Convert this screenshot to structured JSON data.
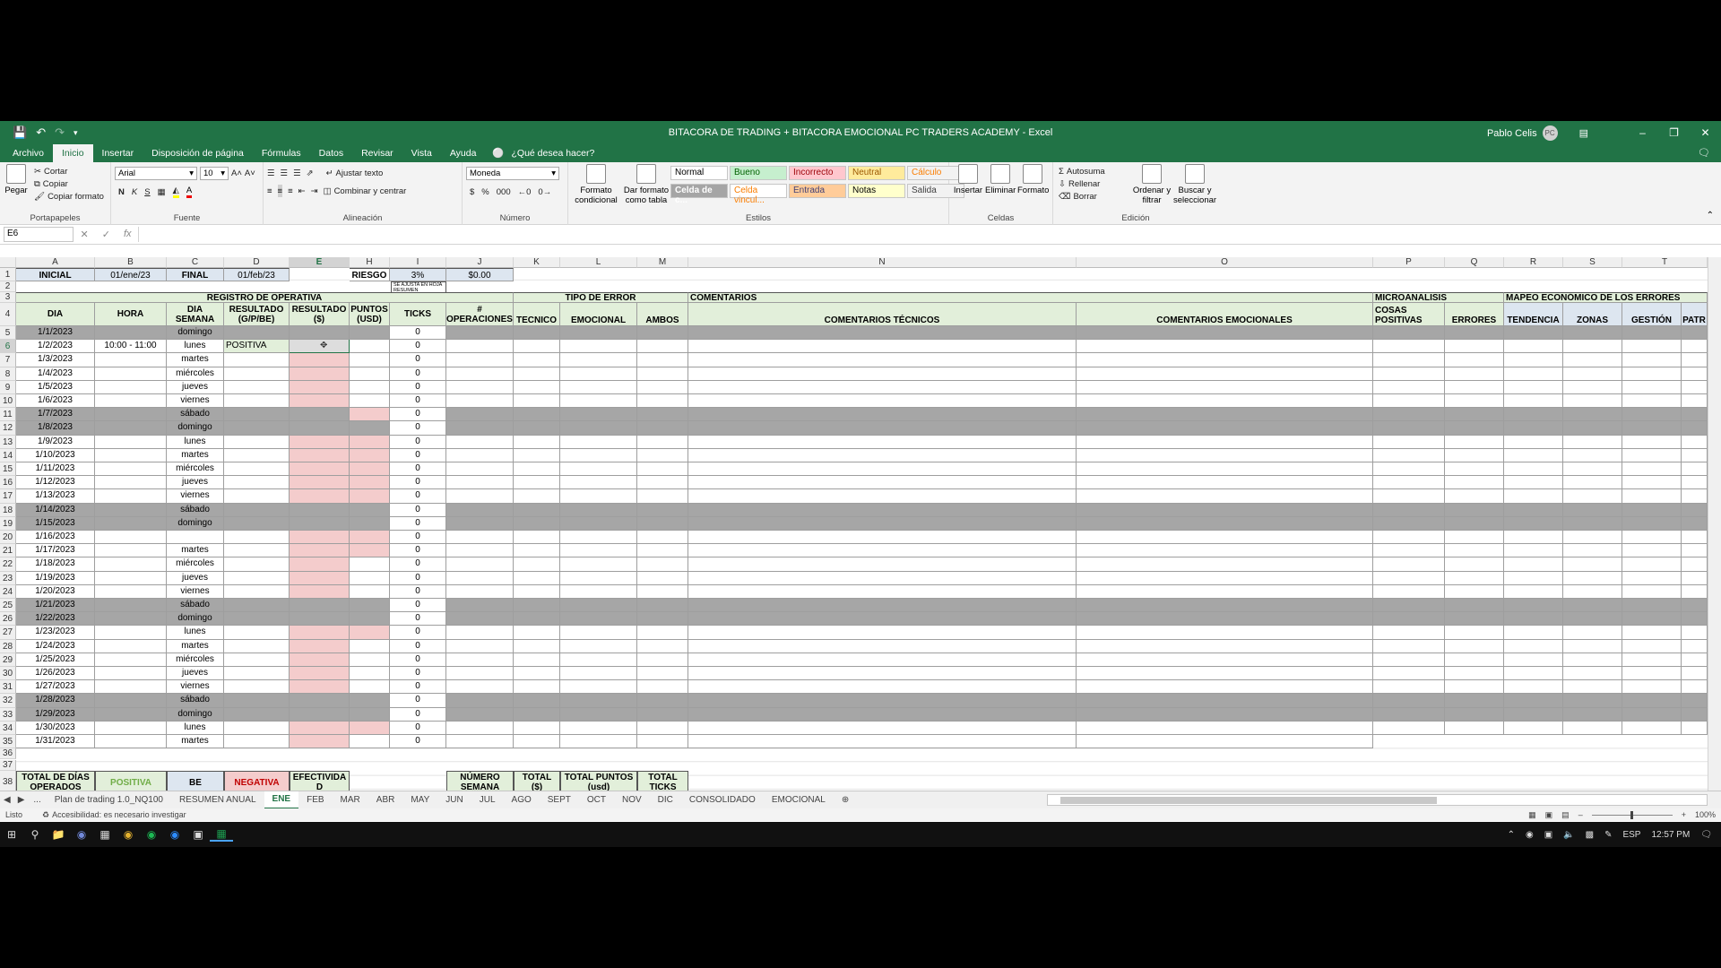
{
  "app": {
    "title": "BITACORA DE TRADING + BITACORA EMOCIONAL PC TRADERS ACADEMY  -  Excel",
    "user": "Pablo Celis",
    "user_initials": "PC"
  },
  "menu": {
    "tabs": [
      "Archivo",
      "Inicio",
      "Insertar",
      "Disposición de página",
      "Fórmulas",
      "Datos",
      "Revisar",
      "Vista",
      "Ayuda"
    ],
    "active": "Inicio",
    "tell_me": "¿Qué desea hacer?"
  },
  "ribbon": {
    "clipboard": {
      "paste": "Pegar",
      "cut": "Cortar",
      "copy": "Copiar",
      "format_painter": "Copiar formato",
      "label": "Portapapeles"
    },
    "font": {
      "name": "Arial",
      "size": "10",
      "bold": "N",
      "italic": "K",
      "underline": "S",
      "label": "Fuente"
    },
    "alignment": {
      "wrap": "Ajustar texto",
      "merge": "Combinar y centrar",
      "label": "Alineación"
    },
    "number": {
      "format": "Moneda",
      "label": "Número"
    },
    "styles": {
      "conditional": "Formato condicional",
      "as_table": "Dar formato como tabla",
      "label": "Estilos",
      "cells": [
        {
          "name": "Normal",
          "bg": "#ffffff",
          "fg": "#000000"
        },
        {
          "name": "Bueno",
          "bg": "#c6efce",
          "fg": "#006100"
        },
        {
          "name": "Incorrecto",
          "bg": "#ffc7ce",
          "fg": "#9c0006"
        },
        {
          "name": "Neutral",
          "bg": "#ffeb9c",
          "fg": "#9c5700"
        },
        {
          "name": "Cálculo",
          "bg": "#f2f2f2",
          "fg": "#fa7d00"
        },
        {
          "name": "Celda de c...",
          "bg": "#a5a5a5",
          "fg": "#ffffff"
        },
        {
          "name": "Celda vincul...",
          "bg": "#ffffff",
          "fg": "#fa7d00"
        },
        {
          "name": "Entrada",
          "bg": "#ffcc99",
          "fg": "#3f3f76"
        },
        {
          "name": "Notas",
          "bg": "#ffffcc",
          "fg": "#000000"
        },
        {
          "name": "Salida",
          "bg": "#f2f2f2",
          "fg": "#3f3f3f"
        }
      ]
    },
    "cells": {
      "insert": "Insertar",
      "delete": "Eliminar",
      "format": "Formato",
      "label": "Celdas"
    },
    "editing": {
      "autosum": "Autosuma",
      "fill": "Rellenar",
      "clear": "Borrar",
      "sort": "Ordenar y filtrar",
      "find": "Buscar y seleccionar",
      "label": "Edición"
    }
  },
  "formula": {
    "namebox": "E6",
    "content": ""
  },
  "columns": [
    "A",
    "B",
    "C",
    "D",
    "E",
    "",
    "H",
    "I",
    "J",
    "K",
    "L",
    "M",
    "N",
    "O",
    "P",
    "Q",
    "R",
    "S",
    "T"
  ],
  "header": {
    "inicial": "INICIAL",
    "fecha_inicial": "01/ene/23",
    "final": "FINAL",
    "fecha_final": "01/feb/23",
    "riesgo": "RIESGO",
    "riesgo_val": "3%",
    "j1": "$0.00",
    "note": "SE AJUSTA EN HOJA RESUMEN"
  },
  "sections": {
    "registro": "REGISTRO DE OPERATIVA",
    "tipo_error": "TIPO DE ERROR",
    "comentarios": "COMENTARIOS",
    "microanalisis": "MICROANALISIS",
    "mapeo": "MAPEO ECONÓMICO DE LOS ERRORES"
  },
  "col_headers": {
    "dia": "DIA",
    "hora": "HORA",
    "dia_semana": "DIA SEMANA",
    "resultado_gpbe": "RESULTADO (G/P/BE)",
    "resultado_usd": "RESULTADO ($)",
    "puntos": "PUNTOS (USD)",
    "ticks": "TICKS",
    "operaciones": "# OPERACIONES",
    "tecnico": "TECNICO",
    "emocional": "EMOCIONAL",
    "ambos": "AMBOS",
    "com_tecnicos": "COMENTARIOS TÉCNICOS",
    "com_emocionales": "COMENTARIOS EMOCIONALES",
    "cosas_positivas": "COSAS POSITIVAS",
    "errores": "ERRORES",
    "tendencia": "TENDENCIA",
    "zonas": "ZONAS",
    "gestion": "GESTIÓN",
    "patr": "PATR"
  },
  "rows": [
    {
      "n": "5",
      "date": "1/1/2023",
      "hour": "",
      "wd": "domingo",
      "res": "",
      "ticks": "0",
      "weekend": true,
      "h": false
    },
    {
      "n": "6",
      "date": "1/2/2023",
      "hour": "10:00  -  11:00",
      "wd": "lunes",
      "res": "POSITIVA",
      "ticks": "0",
      "weekend": false,
      "h": false
    },
    {
      "n": "7",
      "date": "1/3/2023",
      "hour": "",
      "wd": "martes",
      "res": "",
      "ticks": "0",
      "weekend": false,
      "h": false
    },
    {
      "n": "8",
      "date": "1/4/2023",
      "hour": "",
      "wd": "miércoles",
      "res": "",
      "ticks": "0",
      "weekend": false,
      "h": false
    },
    {
      "n": "9",
      "date": "1/5/2023",
      "hour": "",
      "wd": "jueves",
      "res": "",
      "ticks": "0",
      "weekend": false,
      "h": false
    },
    {
      "n": "10",
      "date": "1/6/2023",
      "hour": "",
      "wd": "viernes",
      "res": "",
      "ticks": "0",
      "weekend": false,
      "h": false
    },
    {
      "n": "11",
      "date": "1/7/2023",
      "hour": "",
      "wd": "sábado",
      "res": "",
      "ticks": "0",
      "weekend": true,
      "h": true
    },
    {
      "n": "12",
      "date": "1/8/2023",
      "hour": "",
      "wd": "domingo",
      "res": "",
      "ticks": "0",
      "weekend": true,
      "h": false
    },
    {
      "n": "13",
      "date": "1/9/2023",
      "hour": "",
      "wd": "lunes",
      "res": "",
      "ticks": "0",
      "weekend": false,
      "h": true
    },
    {
      "n": "14",
      "date": "1/10/2023",
      "hour": "",
      "wd": "martes",
      "res": "",
      "ticks": "0",
      "weekend": false,
      "h": true
    },
    {
      "n": "15",
      "date": "1/11/2023",
      "hour": "",
      "wd": "miércoles",
      "res": "",
      "ticks": "0",
      "weekend": false,
      "h": true
    },
    {
      "n": "16",
      "date": "1/12/2023",
      "hour": "",
      "wd": "jueves",
      "res": "",
      "ticks": "0",
      "weekend": false,
      "h": true
    },
    {
      "n": "17",
      "date": "1/13/2023",
      "hour": "",
      "wd": "viernes",
      "res": "",
      "ticks": "0",
      "weekend": false,
      "h": true
    },
    {
      "n": "18",
      "date": "1/14/2023",
      "hour": "",
      "wd": "sábado",
      "res": "",
      "ticks": "0",
      "weekend": true,
      "h": false
    },
    {
      "n": "19",
      "date": "1/15/2023",
      "hour": "",
      "wd": "domingo",
      "res": "",
      "ticks": "0",
      "weekend": true,
      "h": false
    },
    {
      "n": "20",
      "date": "1/16/2023",
      "hour": "",
      "wd": "",
      "res": "",
      "ticks": "0",
      "weekend": false,
      "h": true
    },
    {
      "n": "21",
      "date": "1/17/2023",
      "hour": "",
      "wd": "martes",
      "res": "",
      "ticks": "0",
      "weekend": false,
      "h": true
    },
    {
      "n": "22",
      "date": "1/18/2023",
      "hour": "",
      "wd": "miércoles",
      "res": "",
      "ticks": "0",
      "weekend": false,
      "h": false
    },
    {
      "n": "23",
      "date": "1/19/2023",
      "hour": "",
      "wd": "jueves",
      "res": "",
      "ticks": "0",
      "weekend": false,
      "h": false
    },
    {
      "n": "24",
      "date": "1/20/2023",
      "hour": "",
      "wd": "viernes",
      "res": "",
      "ticks": "0",
      "weekend": false,
      "h": false
    },
    {
      "n": "25",
      "date": "1/21/2023",
      "hour": "",
      "wd": "sábado",
      "res": "",
      "ticks": "0",
      "weekend": true,
      "h": false
    },
    {
      "n": "26",
      "date": "1/22/2023",
      "hour": "",
      "wd": "domingo",
      "res": "",
      "ticks": "0",
      "weekend": true,
      "h": false
    },
    {
      "n": "27",
      "date": "1/23/2023",
      "hour": "",
      "wd": "lunes",
      "res": "",
      "ticks": "0",
      "weekend": false,
      "h": true
    },
    {
      "n": "28",
      "date": "1/24/2023",
      "hour": "",
      "wd": "martes",
      "res": "",
      "ticks": "0",
      "weekend": false,
      "h": false
    },
    {
      "n": "29",
      "date": "1/25/2023",
      "hour": "",
      "wd": "miércoles",
      "res": "",
      "ticks": "0",
      "weekend": false,
      "h": false
    },
    {
      "n": "30",
      "date": "1/26/2023",
      "hour": "",
      "wd": "jueves",
      "res": "",
      "ticks": "0",
      "weekend": false,
      "h": false
    },
    {
      "n": "31",
      "date": "1/27/2023",
      "hour": "",
      "wd": "viernes",
      "res": "",
      "ticks": "0",
      "weekend": false,
      "h": false
    },
    {
      "n": "32",
      "date": "1/28/2023",
      "hour": "",
      "wd": "sábado",
      "res": "",
      "ticks": "0",
      "weekend": true,
      "h": false
    },
    {
      "n": "33",
      "date": "1/29/2023",
      "hour": "",
      "wd": "domingo",
      "res": "",
      "ticks": "0",
      "weekend": true,
      "h": false
    },
    {
      "n": "34",
      "date": "1/30/2023",
      "hour": "",
      "wd": "lunes",
      "res": "",
      "ticks": "0",
      "weekend": false,
      "h": true
    },
    {
      "n": "35",
      "date": "1/31/2023",
      "hour": "",
      "wd": "martes",
      "res": "",
      "ticks": "0",
      "weekend": false,
      "h": false
    }
  ],
  "summary": {
    "total_dias": "TOTAL DE DÍAS OPERADOS",
    "positiva": "POSITIVA",
    "be": "BE",
    "negativa": "NEGATIVA",
    "efectividad": "EFECTIVIDA D",
    "numero_semana": "NÚMERO SEMANA",
    "total_usd": "TOTAL ($)",
    "total_puntos": "TOTAL PUNTOS (usd)",
    "total_ticks": "TOTAL TICKS"
  },
  "sheets": [
    "Plan de trading 1.0_NQ100",
    "RESUMEN ANUAL",
    "ENE",
    "FEB",
    "MAR",
    "ABR",
    "MAY",
    "JUN",
    "JUL",
    "AGO",
    "SEPT",
    "OCT",
    "NOV",
    "DIC",
    "CONSOLIDADO",
    "EMOCIONAL"
  ],
  "active_sheet": "ENE",
  "status": {
    "ready": "Listo",
    "accessibility": "Accesibilidad: es necesario investigar",
    "zoom": "100%"
  },
  "taskbar": {
    "lang": "ESP",
    "time": "12:57 PM"
  },
  "colors": {
    "accent": "#217346",
    "band": "#e2efda",
    "band_dark": "#c6e0b4",
    "weekend": "#a6a6a6",
    "pink": "#f4cccc",
    "blue": "#dde6f0"
  }
}
